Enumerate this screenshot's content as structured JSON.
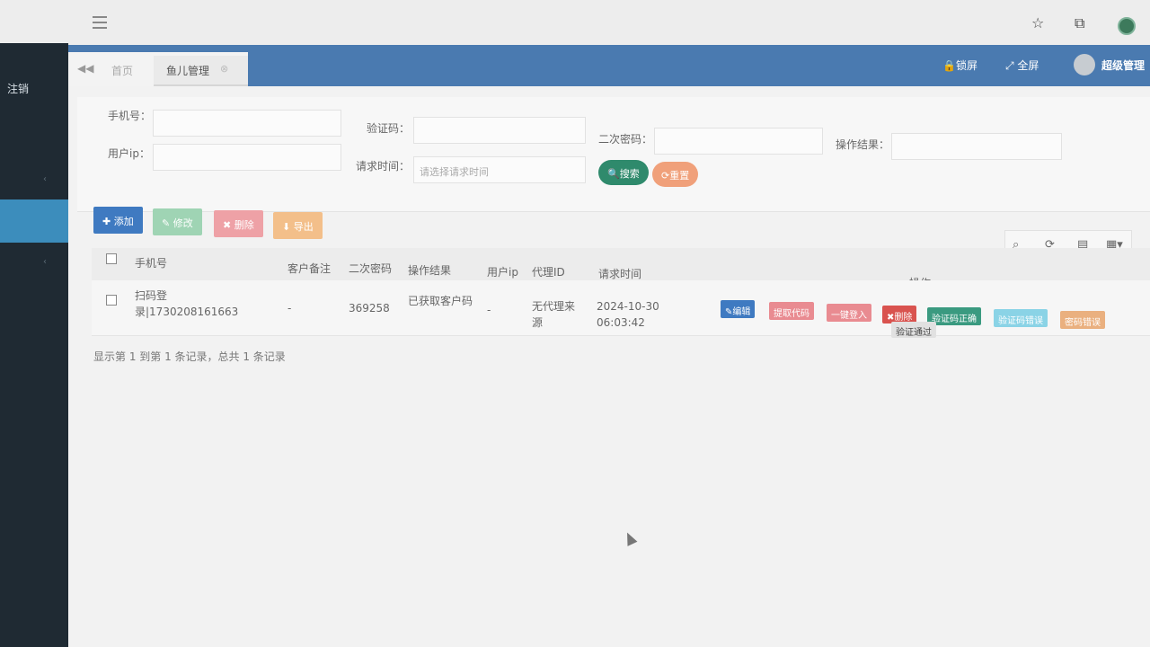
{
  "sidebar": {
    "logout_label": "注销"
  },
  "header": {
    "tab_home": "首页",
    "tab_active": "鱼儿管理",
    "lock_label": "锁屏",
    "fullscreen_label": "全屏",
    "user_name": "超级管理"
  },
  "search": {
    "phone_label": "手机号：",
    "captcha_label": "验证码：",
    "second_pwd_label": "二次密码：",
    "result_label": "操作结果：",
    "user_ip_label": "用户ip：",
    "request_time_label": "请求时间：",
    "request_time_placeholder": "请选择请求时间",
    "search_button": "搜索",
    "reset_button": "重置"
  },
  "toolbar": {
    "add": "添加",
    "edit": "修改",
    "delete": "删除",
    "export": "导出"
  },
  "table": {
    "headers": {
      "phone": "手机号",
      "remark": "客户备注",
      "second_pwd": "二次密码",
      "result": "操作结果",
      "user_ip": "用户ip",
      "agent_id": "代理ID",
      "request_time": "请求时间",
      "actions": "操作"
    },
    "rows": [
      {
        "phone": "扫码登录|1730208161663",
        "remark": "-",
        "second_pwd": "369258",
        "result": "已获取客户码",
        "user_ip": "-",
        "agent_id": "无代理来源",
        "request_time": "2024-10-30 06:03:42",
        "actions": {
          "edit": "编辑",
          "get_code": "提取代码",
          "one_click_login": "一键登入",
          "delete": "删除",
          "captcha_ok": "验证码正确",
          "captcha_err": "验证码错误",
          "pwd_err": "密码错误"
        },
        "status": "验证通过"
      }
    ]
  },
  "pager": {
    "summary": "显示第 1 到第 1 条记录，总共 1 条记录"
  },
  "colors": {
    "header_blue": "#4a7ab0",
    "sidebar_dark": "#1f2a33",
    "primary": "#3f7ac1",
    "success": "#3a9a80",
    "danger": "#d9534f"
  }
}
